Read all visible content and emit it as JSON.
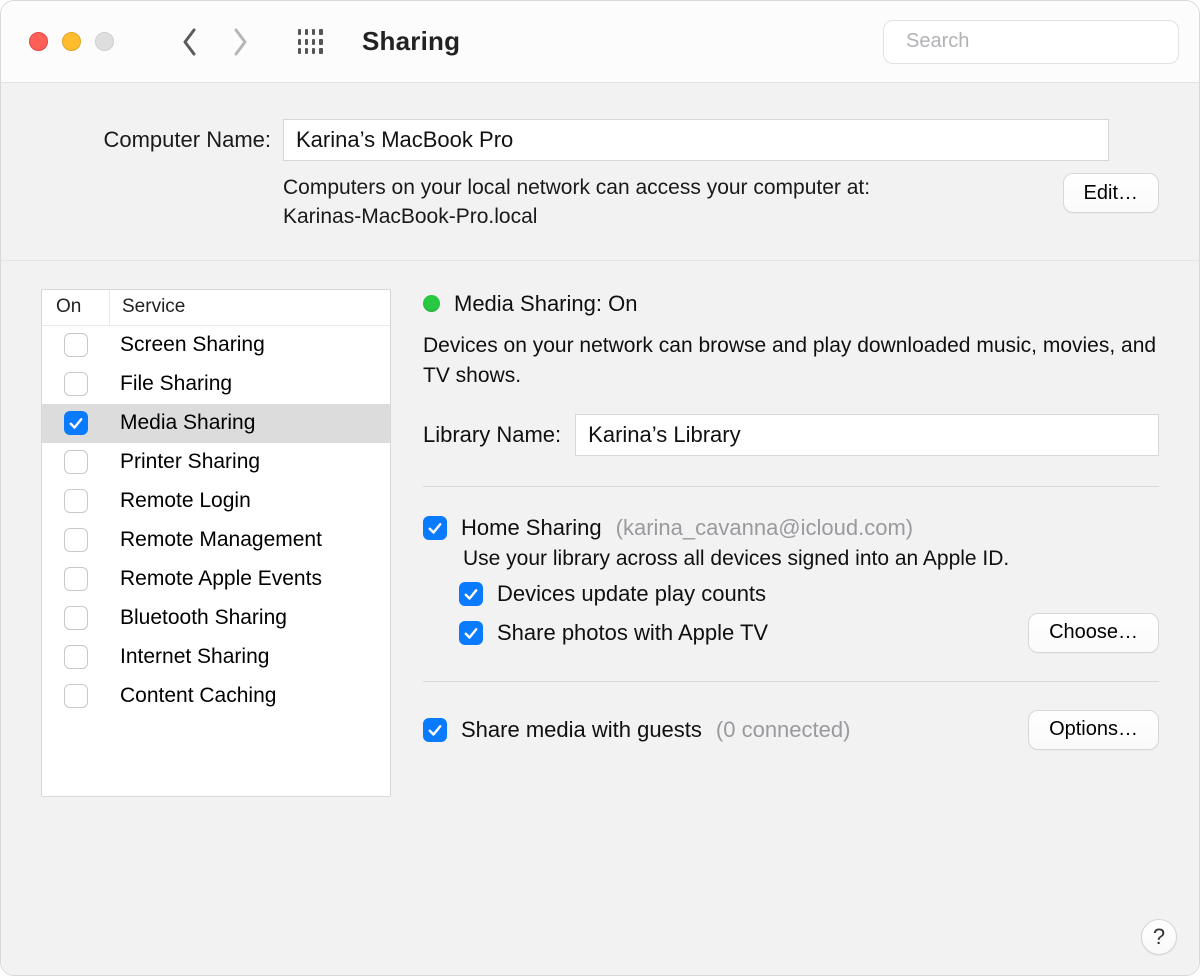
{
  "toolbar": {
    "title": "Sharing",
    "search_placeholder": "Search"
  },
  "computer_name": {
    "label": "Computer Name:",
    "value": "Karina’s MacBook Pro",
    "desc_line1": "Computers on your local network can access your computer at:",
    "desc_line2": "Karinas-MacBook-Pro.local",
    "edit_label": "Edit…"
  },
  "service_table": {
    "col_on": "On",
    "col_service": "Service",
    "items": [
      {
        "label": "Screen Sharing",
        "checked": false,
        "selected": false
      },
      {
        "label": "File Sharing",
        "checked": false,
        "selected": false
      },
      {
        "label": "Media Sharing",
        "checked": true,
        "selected": true
      },
      {
        "label": "Printer Sharing",
        "checked": false,
        "selected": false
      },
      {
        "label": "Remote Login",
        "checked": false,
        "selected": false
      },
      {
        "label": "Remote Management",
        "checked": false,
        "selected": false
      },
      {
        "label": "Remote Apple Events",
        "checked": false,
        "selected": false
      },
      {
        "label": "Bluetooth Sharing",
        "checked": false,
        "selected": false
      },
      {
        "label": "Internet Sharing",
        "checked": false,
        "selected": false
      },
      {
        "label": "Content Caching",
        "checked": false,
        "selected": false
      }
    ]
  },
  "detail": {
    "status_title": "Media Sharing: On",
    "status_desc": "Devices on your network can browse and play downloaded music, movies, and TV shows.",
    "library_label": "Library Name:",
    "library_value": "Karina’s Library",
    "home_sharing": {
      "title": "Home Sharing",
      "account": "(karina_cavanna@icloud.com)",
      "checked": true,
      "desc": "Use your library across all devices signed into an Apple ID.",
      "devices_update": {
        "label": "Devices update play counts",
        "checked": true
      },
      "share_photos": {
        "label": "Share photos with Apple TV",
        "checked": true
      },
      "choose_label": "Choose…"
    },
    "guests": {
      "label": "Share media with guests",
      "meta": "(0 connected)",
      "checked": true,
      "options_label": "Options…"
    }
  },
  "help_label": "?"
}
